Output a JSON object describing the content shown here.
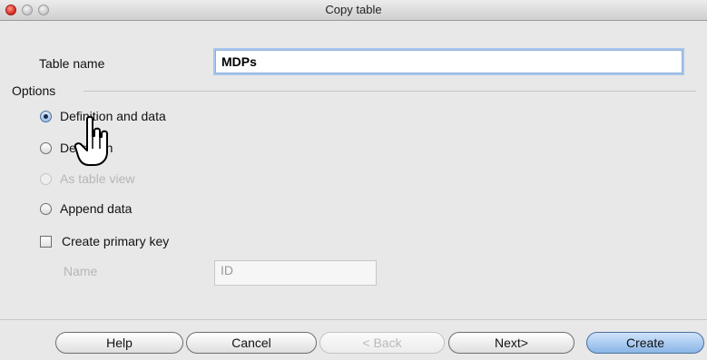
{
  "window": {
    "title": "Copy table"
  },
  "table_name": {
    "label": "Table name",
    "value": "MDPs"
  },
  "options": {
    "label": "Options",
    "items": [
      {
        "label": "Definition and data",
        "checked": true,
        "enabled": true
      },
      {
        "label": "Definition",
        "checked": false,
        "enabled": true
      },
      {
        "label": "As table view",
        "checked": false,
        "enabled": false
      },
      {
        "label": "Append data",
        "checked": false,
        "enabled": true
      }
    ]
  },
  "primary_key": {
    "label": "Create primary key",
    "checked": false,
    "name_label": "Name",
    "name_value": "ID"
  },
  "buttons": {
    "help": "Help",
    "cancel": "Cancel",
    "back": "< Back",
    "next": "Next>",
    "create": "Create"
  },
  "cursor": {
    "icon": "pointing-hand-icon"
  }
}
